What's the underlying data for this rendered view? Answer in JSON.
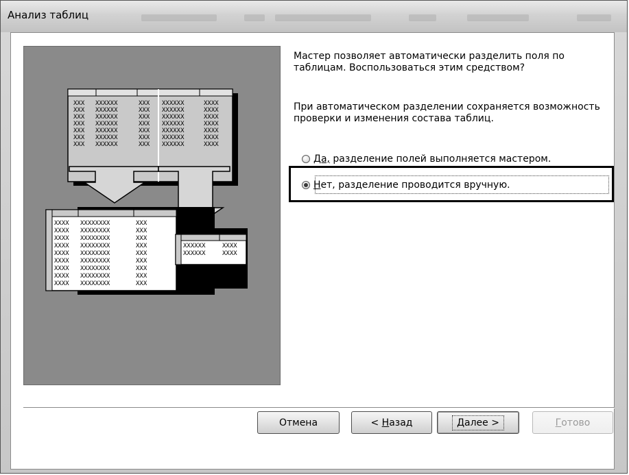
{
  "window": {
    "title": "Анализ таблиц"
  },
  "illustration": {
    "icon": "table-split-diagram-icon",
    "cell_text": "XXX",
    "wide_text": "XXXXXX",
    "wider_text": "XXXXXXXX",
    "small_wide_text": "XXXXXX"
  },
  "main": {
    "description_1": "Мастер позволяет автоматически разделить поля по таблицам. Воспользоваться этим средством?",
    "description_2": "При автоматическом разделении сохраняется возможность проверки и изменения состава таблиц.",
    "options": [
      {
        "label_underlined": "Да,",
        "label_rest": " разделение полей выполняется мастером.",
        "selected": false
      },
      {
        "label_underlined": "Н",
        "label_rest": "ет, разделение проводится вручную.",
        "selected": true
      }
    ]
  },
  "buttons": {
    "cancel": {
      "label": "Отмена",
      "enabled": true
    },
    "back": {
      "label_pre": "< ",
      "label_underlined": "Н",
      "label_rest": "азад",
      "enabled": true
    },
    "next": {
      "label_underlined": "Д",
      "label_rest": "алее >",
      "enabled": true
    },
    "finish": {
      "label_underlined": "Г",
      "label_rest": "отово",
      "enabled": false
    }
  },
  "colors": {
    "illustration_bg": "#8a8a8a",
    "table_fill": "#c9c9c9",
    "shadow": "#000000"
  }
}
